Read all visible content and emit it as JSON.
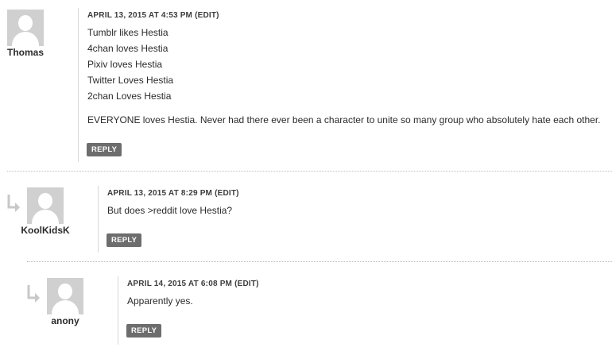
{
  "comments": [
    {
      "author": "Thomas",
      "meta": "APRIL 13, 2015 AT 4:53 PM",
      "edit": "(EDIT)",
      "lines": [
        "Tumblr likes Hestia",
        "4chan loves Hestia",
        "Pixiv loves Hestia",
        "Twitter Loves Hestia",
        "2chan Loves Hestia"
      ],
      "paragraph": "EVERYONE loves Hestia. Never had there ever been a character to unite so many group who absolutely hate each other.",
      "reply_label": "REPLY"
    },
    {
      "author": "KoolKidsK",
      "meta": "APRIL 13, 2015 AT 8:29 PM",
      "edit": "(EDIT)",
      "lines": [
        "But does >reddit love Hestia?"
      ],
      "reply_label": "REPLY"
    },
    {
      "author": "anony",
      "meta": "APRIL 14, 2015 AT 6:08 PM",
      "edit": "(EDIT)",
      "lines": [
        "Apparently yes."
      ],
      "reply_label": "REPLY"
    }
  ],
  "icons": {
    "avatar": "default-avatar-icon",
    "reply_indent": "reply-arrow-icon"
  },
  "colors": {
    "reply_button": "#6d6d6d",
    "avatar_bg": "#d0d0d0",
    "divider": "#d8d8d8"
  }
}
